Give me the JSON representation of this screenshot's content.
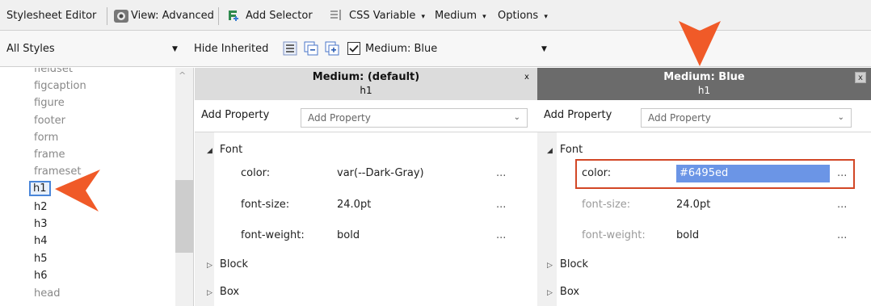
{
  "toolbar1": {
    "title": "Stylesheet Editor",
    "view": "View: Advanced",
    "add_selector": "Add Selector",
    "css_variable": "CSS Variable",
    "medium": "Medium",
    "options": "Options"
  },
  "toolbar2": {
    "styles_select": "All Styles",
    "hide_inherited": "Hide Inherited",
    "medium_checkbox": "Medium: Blue",
    "medium_checked": true
  },
  "selectors": [
    "fieldset",
    "figcaption",
    "figure",
    "footer",
    "form",
    "frame",
    "frameset",
    "h1",
    "h2",
    "h3",
    "h4",
    "h5",
    "h6",
    "head"
  ],
  "selected_selector": "h1",
  "panel_default": {
    "title": "Medium: (default)",
    "selector": "h1",
    "close": "x",
    "add_property_label": "Add Property",
    "add_property_placeholder": "Add Property",
    "group_font": "Font",
    "props": [
      {
        "name": "color:",
        "value": "var(--Dark-Gray)"
      },
      {
        "name": "font-size:",
        "value": "24.0pt"
      },
      {
        "name": "font-weight:",
        "value": "bold"
      }
    ],
    "group_block": "Block",
    "group_box": "Box",
    "ellipsis": "..."
  },
  "panel_blue": {
    "title": "Medium: Blue",
    "selector": "h1",
    "close": "x",
    "add_property_label": "Add Property",
    "add_property_placeholder": "Add Property",
    "group_font": "Font",
    "props": [
      {
        "name": "color:",
        "value": "#6495ed"
      },
      {
        "name": "font-size:",
        "value": "24.0pt"
      },
      {
        "name": "font-weight:",
        "value": "bold"
      }
    ],
    "group_block": "Block",
    "group_box": "Box",
    "ellipsis": "..."
  },
  "colors": {
    "accent_arrow": "#f05a28",
    "highlight_border": "#d24726",
    "selected_value_bg": "#6b95e6",
    "active_panel_header": "#6b6b6b"
  },
  "icons": [
    "stylesheet-view-icon",
    "add-selector-icon",
    "css-variable-icon",
    "dropdown-arrow-icon",
    "group-by-icon",
    "collapse-all-icon",
    "expand-all-icon",
    "checkbox-icon",
    "orange-pointer-icon"
  ]
}
